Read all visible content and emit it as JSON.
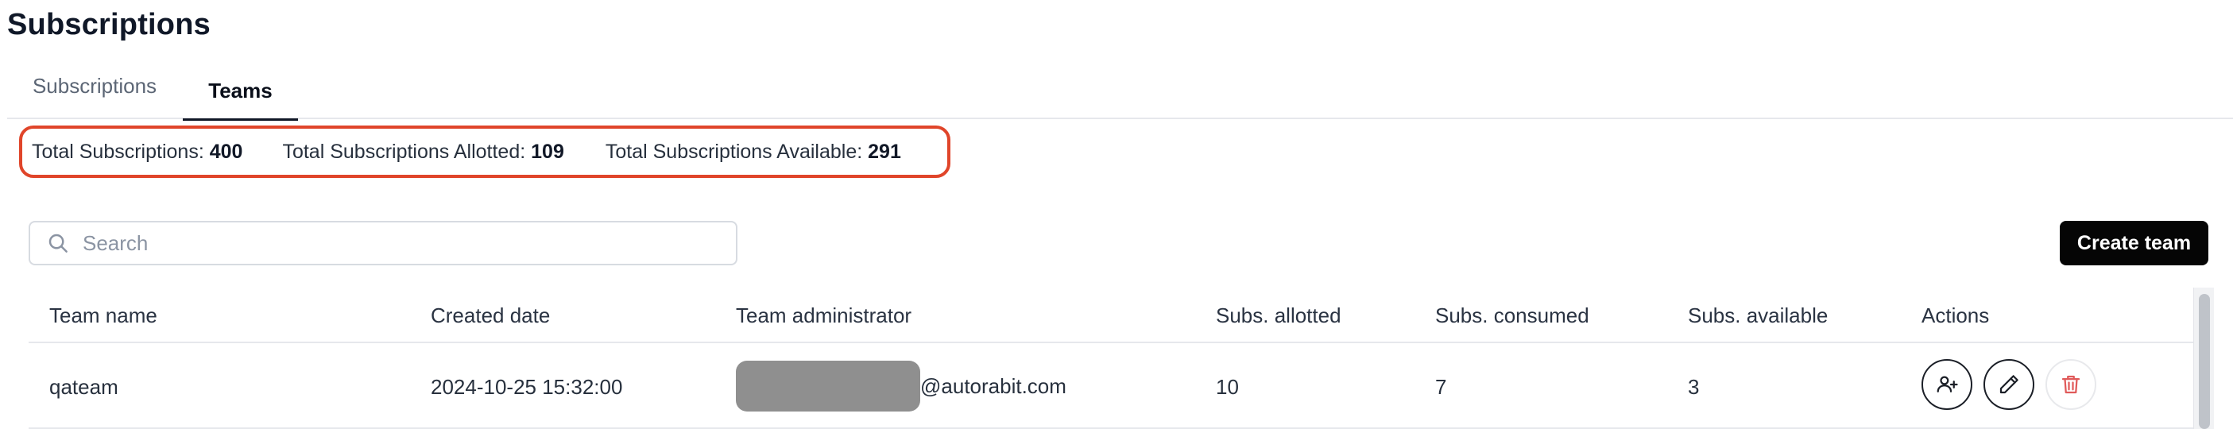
{
  "page": {
    "title": "Subscriptions"
  },
  "tabs": [
    {
      "label": "Subscriptions",
      "active": false
    },
    {
      "label": "Teams",
      "active": true
    }
  ],
  "summary": {
    "total_label": "Total Subscriptions:",
    "total_value": "400",
    "allotted_label": "Total Subscriptions Allotted:",
    "allotted_value": "109",
    "available_label": "Total Subscriptions Available:",
    "available_value": "291",
    "highlight_color": "#e0452a"
  },
  "search": {
    "placeholder": "Search",
    "value": "",
    "icon": "search-icon"
  },
  "toolbar": {
    "create_team_label": "Create team"
  },
  "table": {
    "columns": [
      "Team name",
      "Created date",
      "Team administrator",
      "Subs. allotted",
      "Subs. consumed",
      "Subs. available",
      "Actions"
    ],
    "rows": [
      {
        "team_name": "qateam",
        "created_date": "2024-10-25 15:32:00",
        "admin_domain": "@autorabit.com",
        "admin_redacted": true,
        "subs_allotted": "10",
        "subs_consumed": "7",
        "subs_available": "3",
        "actions": [
          "add-user-icon",
          "edit-icon",
          "trash-icon"
        ]
      }
    ]
  },
  "colors": {
    "primary_button": "#050505",
    "delete_icon": "#e05a5a",
    "accent_border": "#e0452a"
  }
}
